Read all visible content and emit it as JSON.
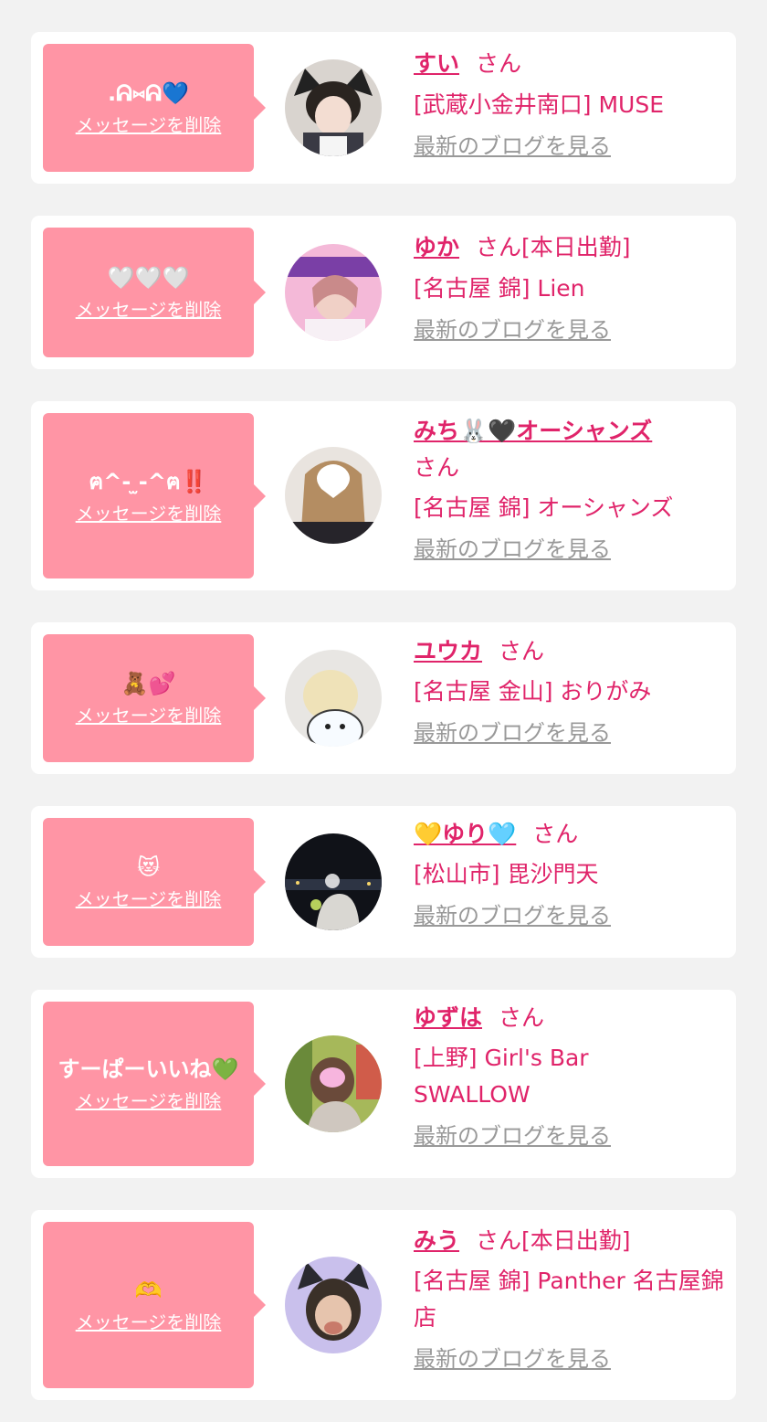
{
  "colors": {
    "page_bg": "#f2f2f2",
    "card_bg": "#ffffff",
    "bubble_bg": "#ff95a5",
    "accent_pink": "#e0246a",
    "link_gray": "#999999"
  },
  "messages": [
    {
      "text": ".ᕱ⑅ᕱ💙",
      "delete": "メッセージを削除",
      "name": "すい",
      "honorific": "さん",
      "status": "",
      "shop": "[武蔵小金井南口] MUSE",
      "blog": "最新のブログを見る"
    },
    {
      "text": "🤍🤍🤍",
      "delete": "メッセージを削除",
      "name": "ゆか",
      "honorific": "さん",
      "status": "[本日出勤]",
      "shop": "[名古屋 錦] Lien",
      "blog": "最新のブログを見る"
    },
    {
      "text": "ฅ^- ̫-^ฅ‼️",
      "delete": "メッセージを削除",
      "name": "みち🐰🖤オーシャンズ",
      "honorific": "さん",
      "status": "",
      "shop": "[名古屋 錦] オーシャンズ",
      "blog": "最新のブログを見る"
    },
    {
      "text": "🧸💕",
      "delete": "メッセージを削除",
      "name": "ユウカ",
      "honorific": "さん",
      "status": "",
      "shop": "[名古屋 金山] おりがみ",
      "blog": "最新のブログを見る"
    },
    {
      "text": "😻",
      "delete": "メッセージを削除",
      "name": "💛ゆり🩵",
      "honorific": "さん",
      "status": "",
      "shop": "[松山市] 毘沙門天",
      "blog": "最新のブログを見る"
    },
    {
      "text": "すーぱーいいね💚",
      "delete": "メッセージを削除",
      "name": "ゆずは",
      "honorific": "さん",
      "status": "",
      "shop": "[上野] Girl's Bar SWALLOW",
      "blog": "最新のブログを見る"
    },
    {
      "text": "🫶",
      "delete": "メッセージを削除",
      "name": "みう",
      "honorific": "さん",
      "status": "[本日出勤]",
      "shop": "[名古屋 錦] Panther 名古屋錦店",
      "blog": "最新のブログを見る"
    }
  ]
}
